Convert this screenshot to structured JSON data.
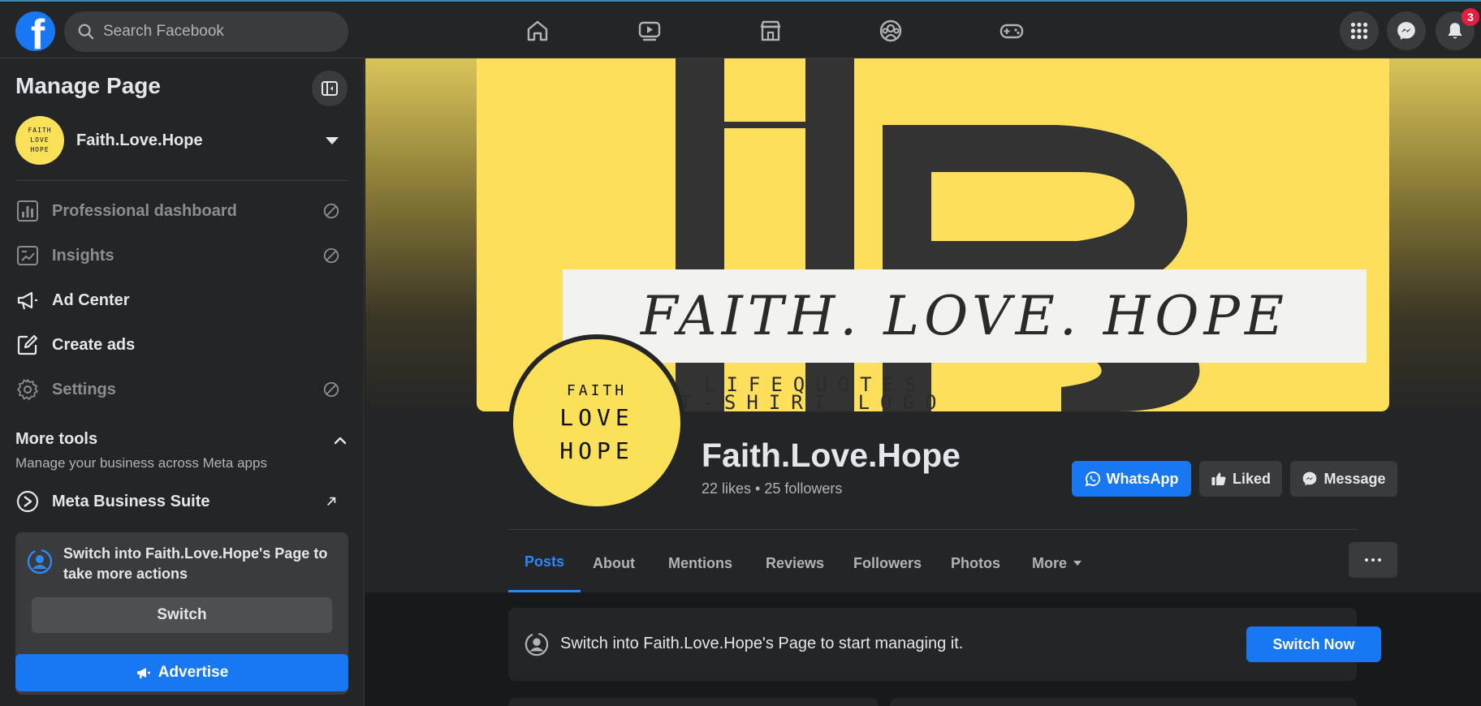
{
  "topbar": {
    "logo_letter": "f",
    "search_placeholder": "Search Facebook",
    "nav_icons": [
      "home-icon",
      "watch-icon",
      "marketplace-icon",
      "groups-icon",
      "gaming-icon"
    ],
    "right_icons": [
      "menu-grid-icon",
      "messenger-icon",
      "notifications-icon"
    ],
    "notification_count": "3"
  },
  "sidebar": {
    "title": "Manage Page",
    "page": {
      "name": "Faith.Love.Hope",
      "avatar_lines": [
        "FAITH",
        "LOVE",
        "HOPE"
      ]
    },
    "menu": [
      {
        "label": "Professional dashboard",
        "icon": "dashboard-icon",
        "disabled": true
      },
      {
        "label": "Insights",
        "icon": "insights-icon",
        "disabled": true
      },
      {
        "label": "Ad Center",
        "icon": "megaphone-icon",
        "disabled": false
      },
      {
        "label": "Create ads",
        "icon": "edit-icon",
        "disabled": false
      },
      {
        "label": "Settings",
        "icon": "gear-icon",
        "disabled": true
      }
    ],
    "more_tools": {
      "title": "More tools",
      "subtitle": "Manage your business across Meta apps",
      "meta_business_suite": "Meta Business Suite"
    },
    "switch_card": {
      "text": "Switch into Faith.Love.Hope's Page to take more actions",
      "button": "Switch"
    },
    "advertise_button": "Advertise"
  },
  "main": {
    "cover": {
      "script_text": "FAITH. LOVE. HOPE",
      "line1": "LIFEQUOTES",
      "line2": "T-SHIRT LOGO",
      "background": "#fddf5c"
    },
    "profile_pic_lines": [
      "FAITH",
      "LOVE",
      "HOPE"
    ],
    "page_title": "Faith.Love.Hope",
    "page_stats": "22 likes • 25 followers",
    "actions": {
      "whatsapp": "WhatsApp",
      "liked": "Liked",
      "message": "Message"
    },
    "tabs": [
      "Posts",
      "About",
      "Mentions",
      "Reviews",
      "Followers",
      "Photos",
      "More"
    ],
    "active_tab": "Posts",
    "banner": {
      "text": "Switch into Faith.Love.Hope's Page to start managing it.",
      "button": "Switch Now"
    }
  },
  "colors": {
    "accent": "#1877f2",
    "link_blue": "#2d88ff",
    "surface": "#242526",
    "background": "#18191a",
    "badge_red": "#e41e3f",
    "brand_yellow": "#fbe05a"
  }
}
